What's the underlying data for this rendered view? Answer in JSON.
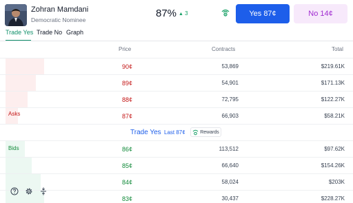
{
  "candidate": {
    "name": "Zohran Mamdani",
    "subtitle": "Democratic Nominee"
  },
  "market": {
    "percent": "87%",
    "delta": "3"
  },
  "actions": {
    "yes_label": "Yes 87¢",
    "no_label": "No 14¢"
  },
  "tabs": [
    {
      "label": "Trade Yes",
      "active": true
    },
    {
      "label": "Trade No",
      "active": false
    },
    {
      "label": "Graph",
      "active": false
    }
  ],
  "columns": {
    "price": "Price",
    "contracts": "Contracts",
    "total": "Total"
  },
  "asks": {
    "label": "Asks",
    "rows": [
      {
        "price": "90¢",
        "contracts": "53,869",
        "total": "$219.61K",
        "depth": 0.11
      },
      {
        "price": "89¢",
        "contracts": "54,901",
        "total": "$171.13K",
        "depth": 0.085
      },
      {
        "price": "88¢",
        "contracts": "72,795",
        "total": "$122.27K",
        "depth": 0.062
      },
      {
        "price": "87¢",
        "contracts": "66,903",
        "total": "$58.21K",
        "depth": 0.036
      }
    ]
  },
  "midbar": {
    "title": "Trade Yes",
    "last": "Last 87¢",
    "rewards": "Rewards"
  },
  "bids": {
    "label": "Bids",
    "rows": [
      {
        "price": "86¢",
        "contracts": "113,512",
        "total": "$97.62K",
        "depth": 0.055
      },
      {
        "price": "85¢",
        "contracts": "66,640",
        "total": "$154.26K",
        "depth": 0.075
      },
      {
        "price": "84¢",
        "contracts": "58,024",
        "total": "$203K",
        "depth": 0.1
      },
      {
        "price": "83¢",
        "contracts": "30,437",
        "total": "$228.27K",
        "depth": 0.11
      }
    ]
  },
  "colors": {
    "accent": "#1d5eea",
    "ask": "#c41818",
    "bid": "#128a3a",
    "tab_active": "#10906a",
    "no_button_bg": "#f7e9fb"
  },
  "footer_icons": [
    "help-icon",
    "settings-icon",
    "collapse-icon"
  ]
}
